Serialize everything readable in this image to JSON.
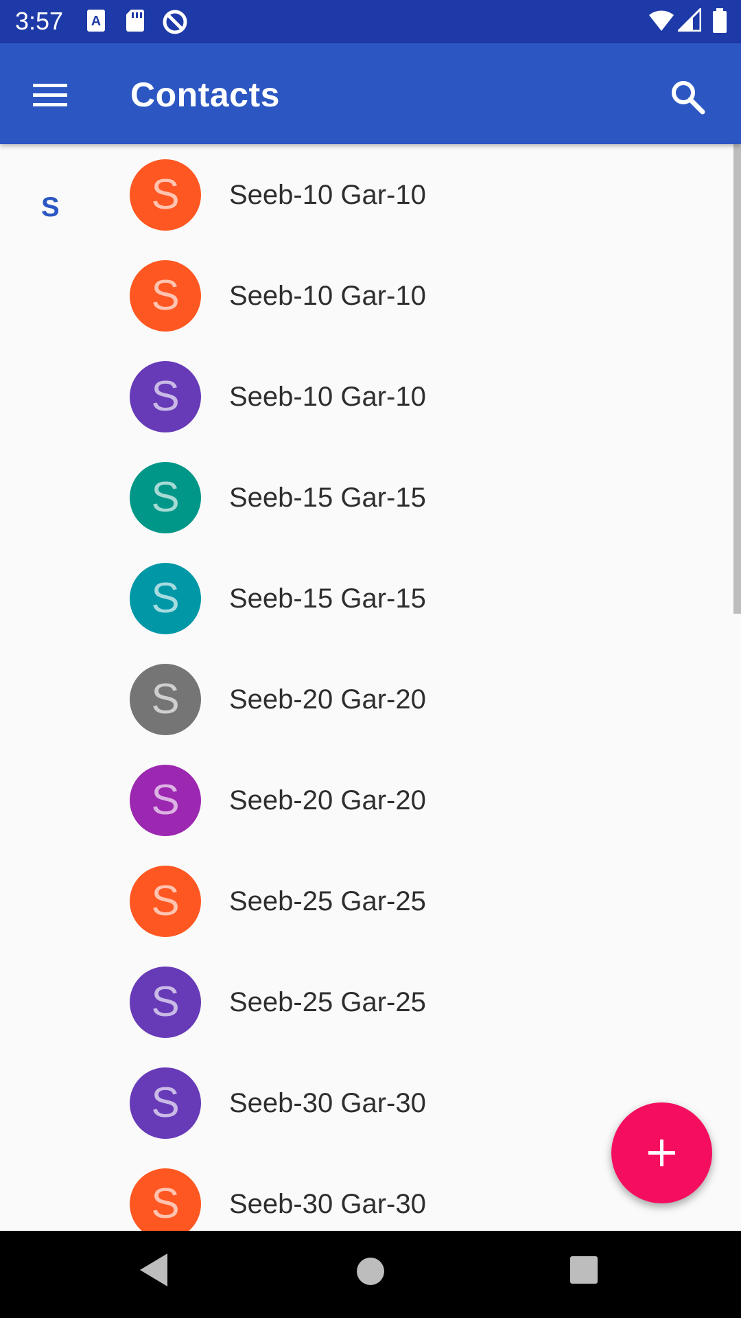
{
  "status_bar": {
    "time": "3:57",
    "icons": [
      "a-notification-icon",
      "sd-card-icon",
      "data-saver-icon",
      "wifi-icon",
      "signal-icon",
      "battery-icon"
    ]
  },
  "app_bar": {
    "title": "Contacts",
    "menu_icon": "menu-icon",
    "search_icon": "search-icon",
    "color": "#2c57c3"
  },
  "contacts": {
    "section_letter": "S",
    "items": [
      {
        "initial": "S",
        "name": "Seeb-10 Gar-10",
        "color": "#ff5722"
      },
      {
        "initial": "S",
        "name": "Seeb-10 Gar-10",
        "color": "#ff5722"
      },
      {
        "initial": "S",
        "name": "Seeb-10 Gar-10",
        "color": "#673ab7"
      },
      {
        "initial": "S",
        "name": "Seeb-15 Gar-15",
        "color": "#009688"
      },
      {
        "initial": "S",
        "name": "Seeb-15 Gar-15",
        "color": "#0097a7"
      },
      {
        "initial": "S",
        "name": "Seeb-20 Gar-20",
        "color": "#757575"
      },
      {
        "initial": "S",
        "name": "Seeb-20 Gar-20",
        "color": "#9c27b0"
      },
      {
        "initial": "S",
        "name": "Seeb-25 Gar-25",
        "color": "#ff5722"
      },
      {
        "initial": "S",
        "name": "Seeb-25 Gar-25",
        "color": "#673ab7"
      },
      {
        "initial": "S",
        "name": "Seeb-30 Gar-30",
        "color": "#673ab7"
      },
      {
        "initial": "S",
        "name": "Seeb-30 Gar-30",
        "color": "#ff5722"
      }
    ]
  },
  "fab": {
    "icon": "plus-icon",
    "color": "#f50e5f"
  },
  "nav_bar": {
    "icons": [
      "back-icon",
      "home-icon",
      "recents-icon"
    ]
  }
}
